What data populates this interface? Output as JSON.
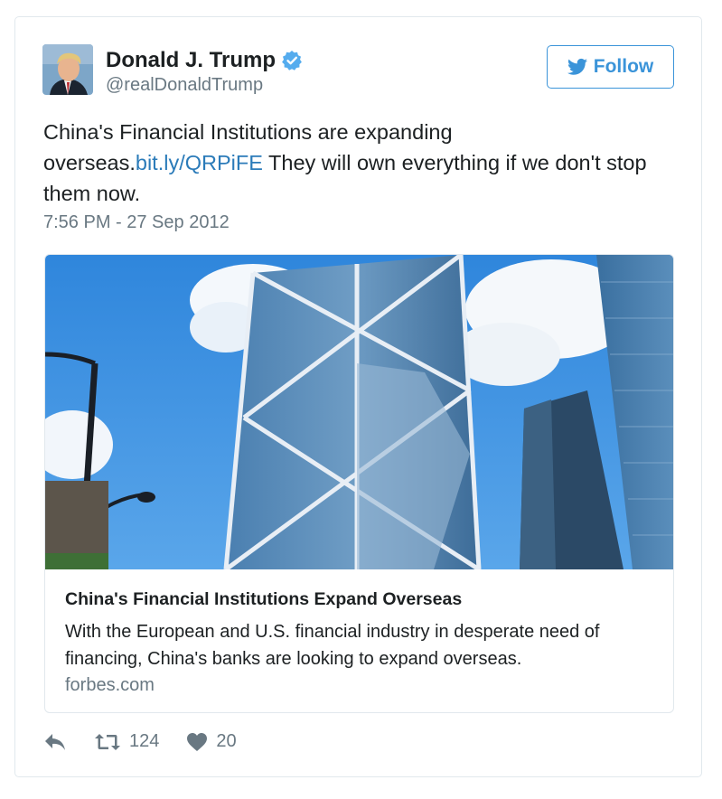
{
  "author": {
    "display_name": "Donald J. Trump",
    "handle": "@realDonaldTrump",
    "verified_icon": "verified-badge-icon"
  },
  "follow_button": {
    "label": "Follow",
    "icon": "twitter-bird-icon"
  },
  "tweet": {
    "text_before": "China's Financial Institutions are expanding overseas.",
    "link": "bit.ly/QRPiFE",
    "text_after": " They will own everything if we don't stop them now.",
    "timestamp": "7:56 PM - 27 Sep 2012"
  },
  "card": {
    "image": "skyscrapers-photo",
    "title": "China's Financial Institutions Expand Overseas",
    "description": "With the European and U.S. financial industry in desperate need of financing, China's banks are looking to expand overseas.",
    "domain": "forbes.com"
  },
  "actions": {
    "reply_icon": "reply-icon",
    "retweet_icon": "retweet-icon",
    "retweet_count": "124",
    "like_icon": "heart-icon",
    "like_count": "20"
  },
  "colors": {
    "accent": "#3b94d9",
    "link": "#2b7bb9",
    "muted": "#697882",
    "border": "#e1e8ed",
    "sky": "#3a8de0"
  }
}
